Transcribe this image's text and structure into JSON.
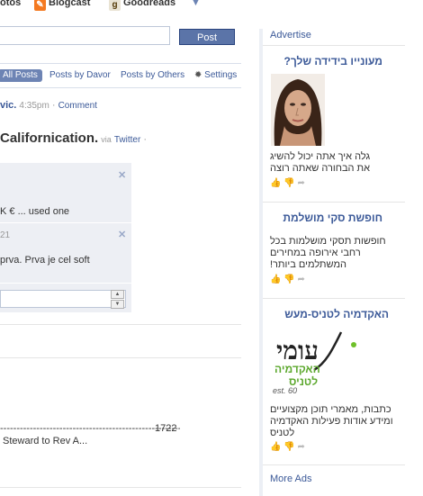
{
  "topbar": {
    "apps": [
      {
        "label": "otos",
        "icon": "photos-icon"
      },
      {
        "label": "Blogcast",
        "icon": "blogcast-icon"
      },
      {
        "label": "Goodreads",
        "icon": "goodreads-icon"
      }
    ],
    "more_icon": "chevron-down-icon"
  },
  "composer": {
    "post_label": "Post"
  },
  "filters": {
    "all": "All Posts",
    "by_owner": "Posts by Davor",
    "by_others": "Posts by Others",
    "settings": "Settings"
  },
  "story1": {
    "author_tail": "vic.",
    "time": "4:35pm",
    "comment_link": "Comment"
  },
  "story2": {
    "text": "Californication.",
    "via": "via",
    "via_source": "Twitter",
    "trail": "·",
    "comments": [
      {
        "text": "K € ... used one"
      },
      {
        "meta": "21",
        "text": "prva. Prva je cel soft"
      }
    ]
  },
  "story3": {
    "dashes": "-----------------------------------------------------------------",
    "number": "1722",
    "text": "Steward to Rev A..."
  },
  "sidebar": {
    "advertise": "Advertise",
    "more_ads": "More Ads",
    "ads": [
      {
        "title": "מעונייו בידידה שלך?",
        "body": "גלה איך אתה יכול להשיג את הבחורה שאתה רוצה"
      },
      {
        "title": "חופשת סקי מושלמת",
        "body": "חופשות תסקי מושלמות בכל רחבי אירופה במחירים המשתלמים ביותר!"
      },
      {
        "title": "האקדמיה לטניס-מעש",
        "body": "כתבות, מאמרי תוכן מקצועיים ומידע אודות פעילות האקדמיה לטניס",
        "logo_main": "עומי",
        "logo_line1": "האקדמיה",
        "logo_line2": "לטניס",
        "logo_year": "est. 60"
      }
    ]
  },
  "colors": {
    "brand": "#3b5998",
    "button": "#5b74a8",
    "panel": "#edeff4"
  }
}
